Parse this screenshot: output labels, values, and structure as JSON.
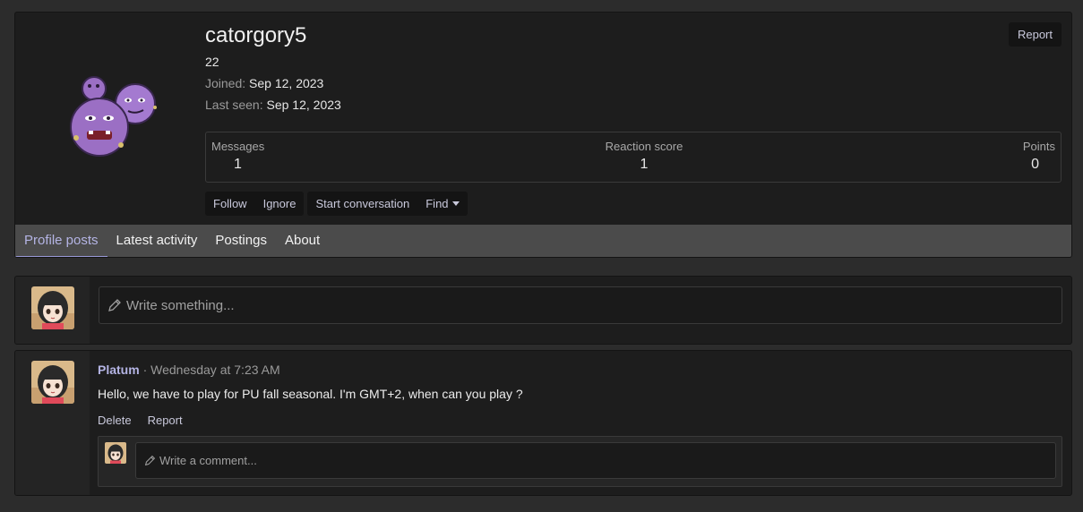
{
  "profile": {
    "username": "catorgory5",
    "age": "22",
    "joined_label": "Joined:",
    "joined_value": "Sep 12, 2023",
    "last_seen_label": "Last seen:",
    "last_seen_value": "Sep 12, 2023",
    "report_label": "Report",
    "avatar_icon": "koffing-sprite-icon"
  },
  "stats": {
    "messages_label": "Messages",
    "messages_value": "1",
    "reaction_label": "Reaction score",
    "reaction_value": "1",
    "points_label": "Points",
    "points_value": "0"
  },
  "actions": {
    "follow": "Follow",
    "ignore": "Ignore",
    "start_conversation": "Start conversation",
    "find": "Find"
  },
  "tabs": [
    {
      "label": "Profile posts",
      "active": true
    },
    {
      "label": "Latest activity",
      "active": false
    },
    {
      "label": "Postings",
      "active": false
    },
    {
      "label": "About",
      "active": false
    }
  ],
  "composer": {
    "placeholder": "Write something..."
  },
  "post": {
    "author": "Platum",
    "time": "· Wednesday at 7:23 AM",
    "text": "Hello, we have to play for PU fall seasonal. I'm GMT+2, when can you play ?",
    "delete_label": "Delete",
    "report_label": "Report",
    "comment_placeholder": "Write a comment..."
  },
  "colors": {
    "background": "#2c2c2c",
    "panel": "#1d1d1d",
    "accent": "#b4b4e4",
    "tab_bar": "#4b4b4b"
  }
}
